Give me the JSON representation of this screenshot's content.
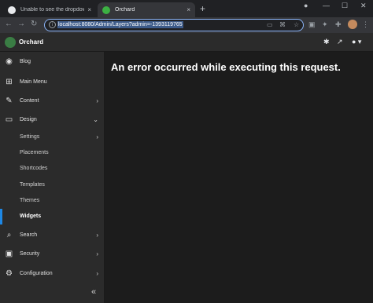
{
  "browser": {
    "tabs": [
      {
        "title": "Unable to see the dropdown valu",
        "close": "×"
      },
      {
        "title": "Orchard",
        "close": "×"
      }
    ],
    "new_tab": "+",
    "window_controls": {
      "minimize": "—",
      "maximize": "☐",
      "close": "✕"
    },
    "url": "localhost:8080/Admin/Layers?admin=-1393119765"
  },
  "app": {
    "brand": "Orchard",
    "header_icons": [
      "gear-icon",
      "external-link-icon",
      "user-icon"
    ]
  },
  "sidebar": {
    "items": [
      {
        "label": "Blog",
        "icon": "rss-icon"
      },
      {
        "label": "Main Menu",
        "icon": "sitemap-icon"
      },
      {
        "label": "Content",
        "icon": "edit-icon",
        "chevron": "›"
      },
      {
        "label": "Design",
        "icon": "monitor-icon",
        "chevron": "⌄"
      }
    ],
    "design_sub": [
      {
        "label": "Settings",
        "chevron": "›"
      },
      {
        "label": "Placements"
      },
      {
        "label": "Shortcodes"
      },
      {
        "label": "Templates"
      },
      {
        "label": "Themes"
      },
      {
        "label": "Widgets"
      }
    ],
    "bottom_items": [
      {
        "label": "Search",
        "icon": "search-icon",
        "chevron": "›"
      },
      {
        "label": "Security",
        "icon": "lock-icon",
        "chevron": "›"
      },
      {
        "label": "Configuration",
        "icon": "gear-icon",
        "chevron": "›"
      }
    ],
    "collapse": "«"
  },
  "main": {
    "error": "An error occurred while executing this request."
  },
  "colors": {
    "accent": "#1e88e5",
    "brand": "#3a7d44"
  }
}
